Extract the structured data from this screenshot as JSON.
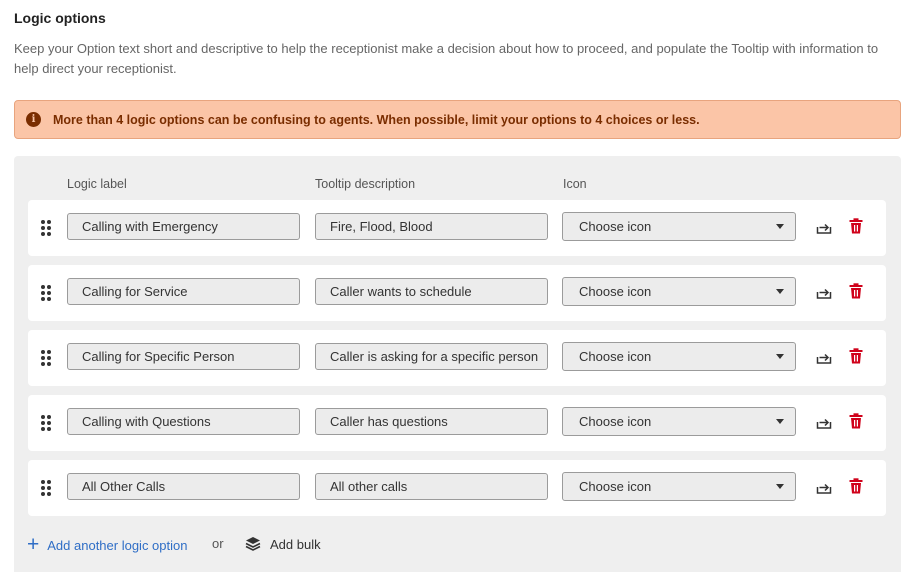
{
  "section": {
    "title": "Logic options",
    "description": "Keep your Option text short and descriptive to help the receptionist make a decision about how to proceed, and populate the Tooltip with information to help direct your receptionist."
  },
  "alert": {
    "icon": "info-icon",
    "text": "More than 4 logic options can be confusing to agents. When possible, limit your options to 4 choices or less."
  },
  "columns": {
    "label": "Logic label",
    "tooltip": "Tooltip description",
    "icon": "Icon"
  },
  "rows": [
    {
      "label": "Calling with Emergency",
      "tooltip": "Fire, Flood, Blood",
      "icon_select": "Choose icon"
    },
    {
      "label": "Calling for Service",
      "tooltip": "Caller wants to schedule",
      "icon_select": "Choose icon"
    },
    {
      "label": "Calling for Specific Person",
      "tooltip": "Caller is asking for a specific person",
      "icon_select": "Choose icon"
    },
    {
      "label": "Calling with Questions",
      "tooltip": "Caller has questions",
      "icon_select": "Choose icon"
    },
    {
      "label": "All Other Calls",
      "tooltip": "All other calls",
      "icon_select": "Choose icon"
    }
  ],
  "actions": {
    "add_option": "Add another logic option",
    "or": "or",
    "add_bulk": "Add bulk"
  },
  "colors": {
    "alert_bg": "#fbc5a7",
    "alert_text": "#7a2d00",
    "link": "#2f6ec6",
    "delete": "#d0021b"
  }
}
